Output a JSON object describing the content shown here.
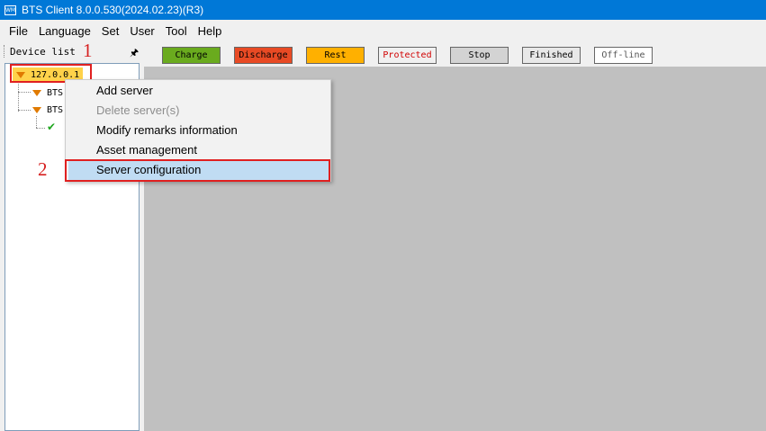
{
  "window": {
    "title": "BTS Client 8.0.0.530(2024.02.23)(R3)",
    "icon_text": "WM"
  },
  "menu": [
    "File",
    "Language",
    "Set",
    "User",
    "Tool",
    "Help"
  ],
  "device_list": {
    "title": "Device list",
    "pin_icon": "pin-icon",
    "root": "127.0.0.1",
    "children": [
      "BTS",
      "BTS"
    ],
    "leaf_icon": "check-icon"
  },
  "status_buttons": [
    {
      "label": "Charge",
      "bg": "#6aab1e",
      "fg": "#000000"
    },
    {
      "label": "Discharge",
      "bg": "#e84a24",
      "fg": "#000000"
    },
    {
      "label": "Rest",
      "bg": "#ffb000",
      "fg": "#000000"
    },
    {
      "label": "Protected",
      "bg": "#f0f0f0",
      "fg": "#d00000"
    },
    {
      "label": "Stop",
      "bg": "#d3d3d3",
      "fg": "#000000"
    },
    {
      "label": "Finished",
      "bg": "#e8e8e8",
      "fg": "#000000"
    },
    {
      "label": "Off-line",
      "bg": "#ffffff",
      "fg": "#555555"
    }
  ],
  "context_menu": {
    "items": [
      {
        "label": "Add server",
        "enabled": true
      },
      {
        "label": "Delete server(s)",
        "enabled": false
      },
      {
        "label": "Modify remarks information",
        "enabled": true
      },
      {
        "label": "Asset management",
        "enabled": true
      },
      {
        "label": "Server configuration",
        "enabled": true,
        "highlighted": true
      }
    ]
  },
  "annotations": {
    "step1": "1",
    "step2": "2"
  },
  "colors": {
    "titlebar": "#0078d7",
    "highlight": "#c0dcf3",
    "annotation": "#e02020",
    "main_bg": "#c0c0c0"
  }
}
